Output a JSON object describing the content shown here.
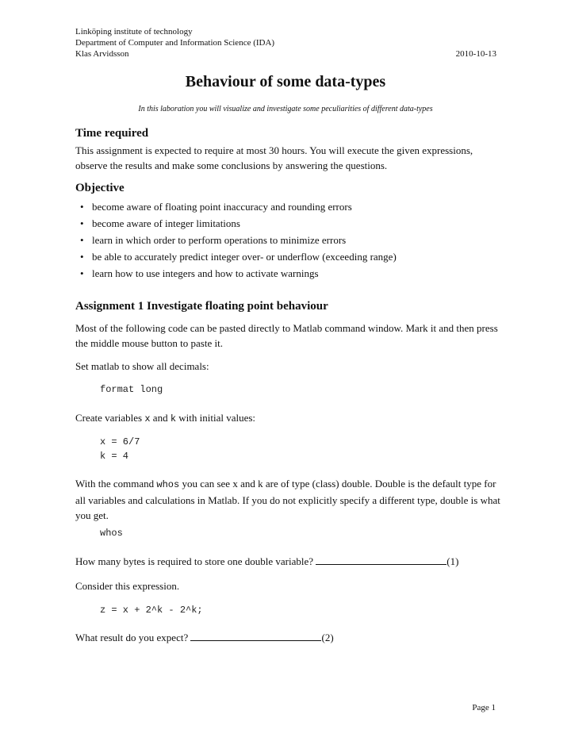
{
  "header": {
    "institution": "Linköping institute of technology",
    "department": "Department of Computer and Information Science (IDA)",
    "author": "Klas Arvidsson",
    "date": "2010-10-13"
  },
  "title": "Behaviour of some data-types",
  "subtitle": "In this laboration you will visualize and investigate some peculiarities of different data-types",
  "time_required": {
    "heading": "Time required",
    "text": "This assignment is expected to require at most 30 hours. You will execute the given expressions, observe the results and make some conclusions by answering the questions."
  },
  "objective": {
    "heading": "Objective",
    "bullet": "•",
    "items": [
      "become aware of floating point inaccuracy and rounding errors",
      "become aware of integer limitations",
      "learn in which order to perform operations to minimize errors",
      "be able to accurately predict integer over- or underflow (exceeding range)",
      "learn how to use integers and how to activate warnings"
    ]
  },
  "assignment1": {
    "heading": "Assignment 1 Investigate floating point behaviour",
    "intro": "Most of the following code can be pasted directly to Matlab command window. Mark it and then press the middle mouse button to paste it.",
    "set_format_text": "Set matlab to show all decimals:",
    "code_format": "format long",
    "create_vars": {
      "prefix": "Create variables ",
      "var_x": "x",
      "and": " and ",
      "var_k": "k",
      "suffix": " with initial values:"
    },
    "code_vars": [
      "x = 6/7",
      "k = 4"
    ],
    "whos_text": {
      "prefix": "With the command ",
      "cmd": "whos",
      "suffix": " you can see x and k are of type (class) double. Double is the default type for all variables and calculations in Matlab. If you do not explicitly specify a different type, double is what you get."
    },
    "code_whos": "whos",
    "question1": {
      "text": "How many bytes is required to store one double variable? ",
      "number": "(1)"
    },
    "consider_text": "Consider this expression.",
    "code_expr": "z = x + 2^k - 2^k;",
    "question2": {
      "text": "What result do you expect? ",
      "number": "(2)"
    }
  },
  "footer": {
    "page": "Page 1"
  }
}
